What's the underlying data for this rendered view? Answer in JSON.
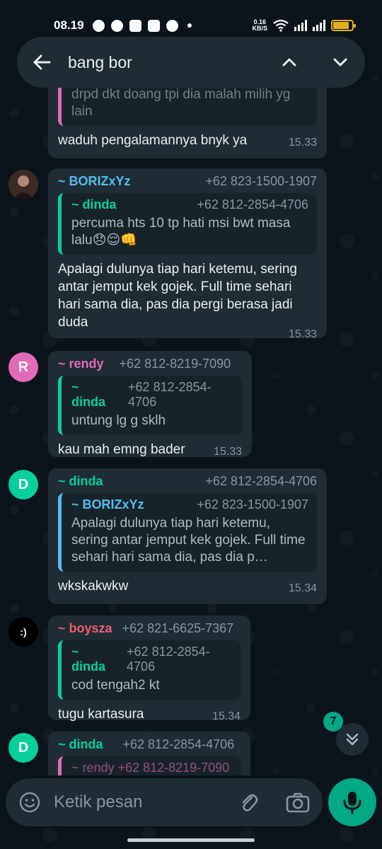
{
  "status_bar": {
    "time": "08.19",
    "net_speed_value": "0.16",
    "net_speed_unit": "KB/S",
    "battery_level": 0.85
  },
  "search": {
    "query": "bang bor"
  },
  "messages": [
    {
      "partial_text": "drpd dkt doang tpi dia malah milih yg lain",
      "text": "waduh pengalamannya bnyk ya",
      "time": "15.33"
    },
    {
      "sender": "~ BORIZxYz",
      "sender_color": "#53bdeb",
      "phone": "+62 823-1500-1907",
      "quote": {
        "sender": "~ dinda",
        "phone": "+62 812-2854-4706",
        "text": "percuma hts 10 tp hati msi bwt masa lalu😞😌👊"
      },
      "text": "Apalagi dulunya tiap hari ketemu, sering antar jemput kek gojek. Full time sehari hari sama dia, pas dia pergi berasa jadi duda",
      "time": "15.33"
    },
    {
      "avatar_letter": "R",
      "sender": "~ rendy",
      "sender_color": "#e26ab6",
      "phone": "+62 812-8219-7090",
      "quote": {
        "sender": "~ dinda",
        "phone": "+62 812-2854-4706",
        "text": "untung lg g sklh"
      },
      "text": "kau mah emng bader",
      "time": "15.33"
    },
    {
      "avatar_letter": "D",
      "sender": "~ dinda",
      "sender_color": "#06cf9c",
      "phone": "+62 812-2854-4706",
      "quote": {
        "sender": "~ BORIZxYz",
        "phone": "+62 823-1500-1907",
        "text": "Apalagi dulunya tiap hari ketemu, sering antar jemput kek gojek. Full time sehari hari sama dia, pas dia p…"
      },
      "text": "wkskakwkw",
      "time": "15.34"
    },
    {
      "avatar_text": ":)",
      "sender": "~ boysza",
      "sender_color": "#f15c6d",
      "phone": "+62 821-6625-7367",
      "quote": {
        "sender": "~ dinda",
        "phone": "+62 812-2854-4706",
        "text": "cod tengah2 kt"
      },
      "text": "tugu kartasura",
      "time": "15.34"
    },
    {
      "avatar_letter": "D",
      "sender": "~ dinda",
      "sender_color": "#06cf9c",
      "phone": "+62 812-2854-4706",
      "quote_partial": "~ rendy   +62 812-8219-7090"
    }
  ],
  "scroll": {
    "unread_count": "7"
  },
  "composer": {
    "placeholder": "Ketik pesan"
  },
  "icons": {
    "back": "arrow-left-icon",
    "prev": "chevron-up-icon",
    "next": "chevron-down-icon",
    "emoji": "emoji-icon",
    "attach": "paperclip-icon",
    "camera": "camera-icon",
    "mic": "microphone-icon"
  },
  "colors": {
    "accent": "#00a884",
    "bubble": "#1f2c34",
    "background": "#0b141a"
  }
}
